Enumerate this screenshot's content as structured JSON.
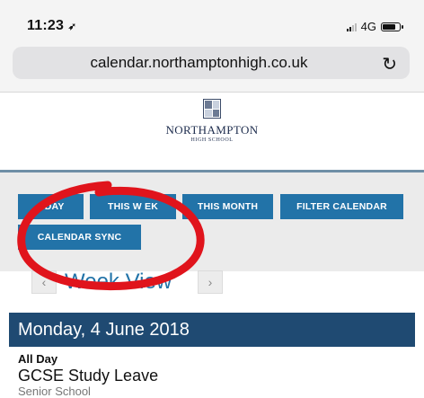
{
  "status": {
    "time": "11:23",
    "location_icon": "location-arrow-icon",
    "network": "4G"
  },
  "browser": {
    "url": "calendar.northamptonhigh.co.uk",
    "reload_icon": "reload-icon"
  },
  "logo": {
    "name": "NORTHAMPTON",
    "sub": "HIGH SCHOOL"
  },
  "toolbar": {
    "today": "ODAY",
    "this_week": "THIS W   EK",
    "this_month": "THIS MONTH",
    "filter": "FILTER CALENDAR",
    "sync": "CALENDAR SYNC"
  },
  "week_nav": {
    "title": "Week View",
    "prev": "‹",
    "next": "›"
  },
  "day": {
    "header": "Monday, 4 June 2018"
  },
  "event": {
    "time": "All Day",
    "title": "GCSE Study Leave",
    "location": "Senior School"
  },
  "colors": {
    "button": "#2273a8",
    "day_header": "#1f4a72",
    "annotation": "#e0141c"
  }
}
